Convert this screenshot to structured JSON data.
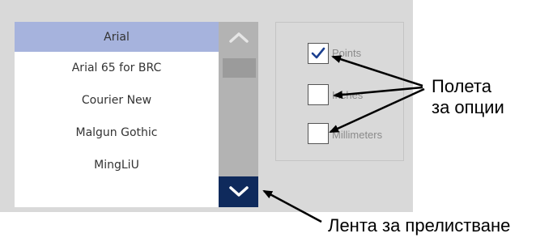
{
  "fonts": {
    "items": [
      "Arial",
      "Arial 65 for BRC",
      "Courier New",
      "Malgun Gothic",
      "MingLiU"
    ],
    "selected": "Arial"
  },
  "scrollbar": {
    "up_icon": "chevron-up-icon",
    "down_icon": "chevron-down-icon"
  },
  "units": {
    "options": [
      {
        "label": "Points",
        "checked": true
      },
      {
        "label": "Inches",
        "checked": false
      },
      {
        "label": "Millimeters",
        "checked": false
      }
    ]
  },
  "callouts": {
    "option_fields_line1": "Полета",
    "option_fields_line2": "за опции",
    "scrollbar": "Лента за прелистване"
  },
  "colors": {
    "selected_row": "#a6b3dd",
    "scroll_down_button": "#0f2a5c",
    "checkmark": "#1b3f8f"
  }
}
